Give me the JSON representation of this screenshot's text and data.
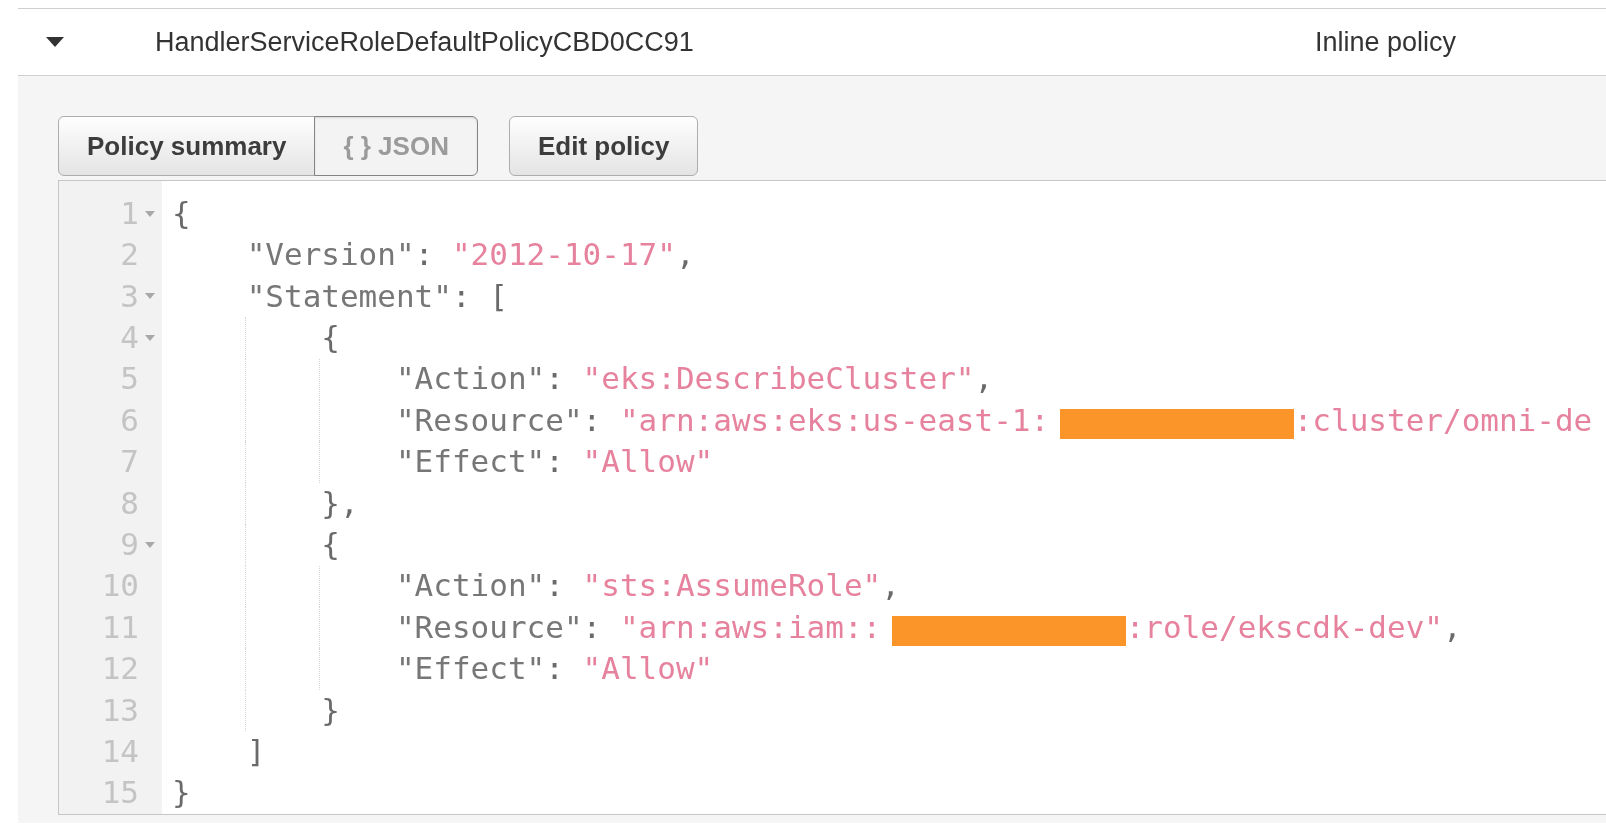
{
  "policy": {
    "expanded": true,
    "name": "HandlerServiceRoleDefaultPolicyCBD0CC91",
    "type": "Inline policy"
  },
  "tabs": [
    {
      "label": "Policy summary",
      "selected": false
    },
    {
      "label": "{ } JSON",
      "selected": true
    }
  ],
  "actions": [
    "Edit policy"
  ],
  "editor": {
    "lines": [
      {
        "number": "1",
        "expanded": true,
        "tokens": [
          {
            "kind": "punct",
            "text": "{"
          }
        ],
        "children": [
          {
            "number": "2",
            "tokens": [
              {
                "kind": "key",
                "text": "\"Version\""
              },
              {
                "kind": "punct",
                "text": ": "
              },
              {
                "kind": "string",
                "text": "\"2012-10-17\""
              },
              {
                "kind": "punct",
                "text": ","
              }
            ]
          },
          {
            "number": "3",
            "expanded": true,
            "tokens": [
              {
                "kind": "key",
                "text": "\"Statement\""
              },
              {
                "kind": "punct",
                "text": ": ["
              }
            ],
            "children": [
              {
                "number": "4",
                "expanded": true,
                "tokens": [
                  {
                    "kind": "punct",
                    "text": "{"
                  }
                ],
                "children": [
                  {
                    "number": "5",
                    "tokens": [
                      {
                        "kind": "key",
                        "text": "\"Action\""
                      },
                      {
                        "kind": "punct",
                        "text": ": "
                      },
                      {
                        "kind": "string",
                        "text": "\"eks:DescribeCluster\""
                      },
                      {
                        "kind": "punct",
                        "text": ","
                      }
                    ]
                  },
                  {
                    "number": "6",
                    "tokens": [
                      {
                        "kind": "key",
                        "text": "\"Resource\""
                      },
                      {
                        "kind": "punct",
                        "text": ": "
                      },
                      {
                        "kind": "string",
                        "text": "\"arn:aws:eks:us-east-1:"
                      },
                      {
                        "kind": "redacted"
                      },
                      {
                        "kind": "string",
                        "text": ":cluster/omni-de"
                      }
                    ]
                  },
                  {
                    "number": "7",
                    "tokens": [
                      {
                        "kind": "key",
                        "text": "\"Effect\""
                      },
                      {
                        "kind": "punct",
                        "text": ": "
                      },
                      {
                        "kind": "string",
                        "text": "\"Allow\""
                      }
                    ]
                  }
                ]
              },
              {
                "number": "8",
                "tokens": [
                  {
                    "kind": "punct",
                    "text": "},"
                  }
                ]
              },
              {
                "number": "9",
                "expanded": true,
                "tokens": [
                  {
                    "kind": "punct",
                    "text": "{"
                  }
                ],
                "children": [
                  {
                    "number": "10",
                    "tokens": [
                      {
                        "kind": "key",
                        "text": "\"Action\""
                      },
                      {
                        "kind": "punct",
                        "text": ": "
                      },
                      {
                        "kind": "string",
                        "text": "\"sts:AssumeRole\""
                      },
                      {
                        "kind": "punct",
                        "text": ","
                      }
                    ]
                  },
                  {
                    "number": "11",
                    "tokens": [
                      {
                        "kind": "key",
                        "text": "\"Resource\""
                      },
                      {
                        "kind": "punct",
                        "text": ": "
                      },
                      {
                        "kind": "string",
                        "text": "\"arn:aws:iam::"
                      },
                      {
                        "kind": "redacted"
                      },
                      {
                        "kind": "string",
                        "text": ":role/ekscdk-dev\""
                      },
                      {
                        "kind": "punct",
                        "text": ","
                      }
                    ]
                  },
                  {
                    "number": "12",
                    "tokens": [
                      {
                        "kind": "key",
                        "text": "\"Effect\""
                      },
                      {
                        "kind": "punct",
                        "text": ": "
                      },
                      {
                        "kind": "string",
                        "text": "\"Allow\""
                      }
                    ]
                  }
                ]
              },
              {
                "number": "13",
                "tokens": [
                  {
                    "kind": "punct",
                    "text": "}"
                  }
                ]
              }
            ]
          },
          {
            "number": "14",
            "tokens": [
              {
                "kind": "punct",
                "text": "]"
              }
            ]
          }
        ]
      },
      {
        "number": "15",
        "tokens": [
          {
            "kind": "punct",
            "text": "}"
          }
        ]
      }
    ]
  }
}
